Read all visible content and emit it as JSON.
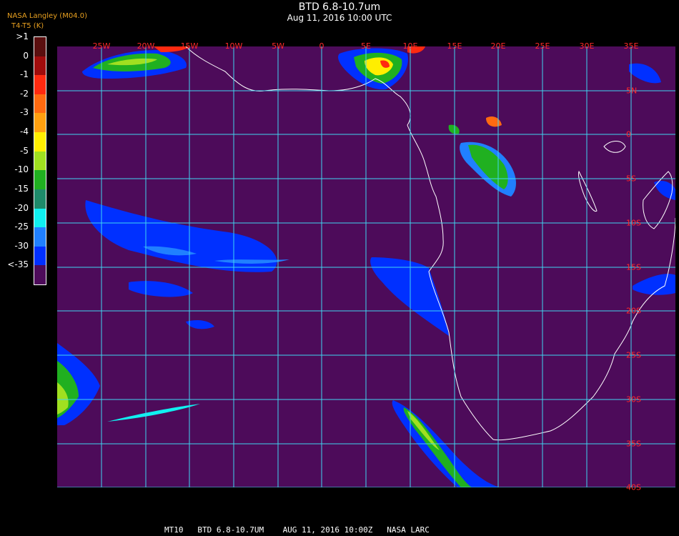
{
  "header": {
    "title": "BTD 6.8-10.7um",
    "datetime": "Aug 11, 2016 10:00 UTC",
    "credit": "NASA Langley (M04.0)",
    "unit_label": "T4-T5 (K)"
  },
  "legend": {
    "bins": [
      {
        "label": ">1",
        "color": "#5a0f0f"
      },
      {
        "label": "0",
        "color": "#a00c0c"
      },
      {
        "label": "-1",
        "color": "#ff2a10"
      },
      {
        "label": "-2",
        "color": "#ff6a10"
      },
      {
        "label": "-3",
        "color": "#ffa010"
      },
      {
        "label": "-4",
        "color": "#ffee00"
      },
      {
        "label": "-5",
        "color": "#a0e020"
      },
      {
        "label": "-10",
        "color": "#20b020"
      },
      {
        "label": "-15",
        "color": "#1e8a6a"
      },
      {
        "label": "-20",
        "color": "#10f0f0"
      },
      {
        "label": "-25",
        "color": "#2080ff"
      },
      {
        "label": "-30",
        "color": "#0030ff"
      },
      {
        "label": "<-35",
        "color": "#4d0b5a"
      }
    ]
  },
  "map": {
    "longitudes": [
      "25W",
      "20W",
      "15W",
      "10W",
      "5W",
      "0",
      "5E",
      "10E",
      "15E",
      "20E",
      "25E",
      "30E",
      "35E"
    ],
    "latitudes": [
      "5N",
      "0",
      "5S",
      "10S",
      "15S",
      "20S",
      "25S",
      "30S",
      "35S",
      "40S"
    ],
    "background_color": "#4d0b5a",
    "grid_color": "#3fd6f0",
    "label_color": "#ff2a2a",
    "coast_color": "#ffffff"
  },
  "footer": {
    "text": "MT10   BTD 6.8-10.7UM    AUG 11, 2016 10:00Z   NASA LARC"
  }
}
